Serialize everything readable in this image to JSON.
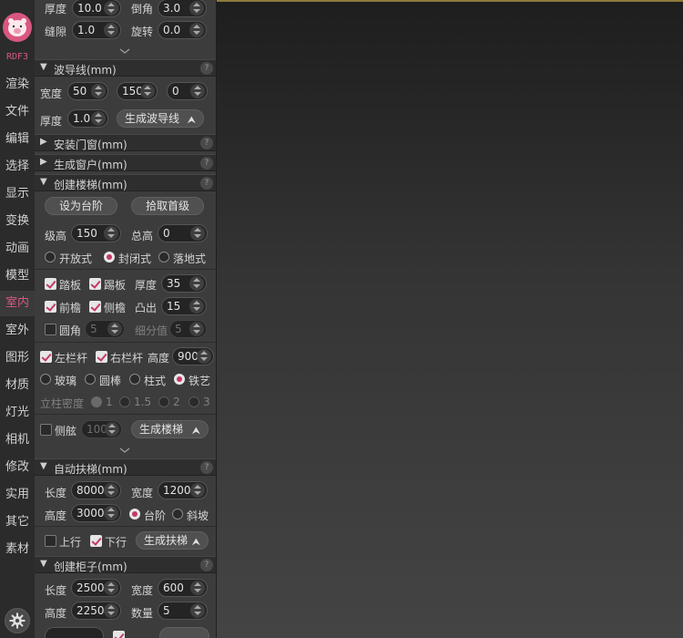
{
  "brand": {
    "logo_text": "RDF3",
    "accent": "#d9577f"
  },
  "nav": [
    "渲染",
    "文件",
    "编辑",
    "选择",
    "显示",
    "变换",
    "动画",
    "模型",
    "室内",
    "室外",
    "图形",
    "材质",
    "灯光",
    "相机",
    "修改",
    "实用",
    "其它",
    "素材"
  ],
  "nav_active": "室内",
  "top": {
    "thickness_label": "厚度",
    "thickness": "10.0",
    "chamfer_label": "倒角",
    "chamfer": "3.0",
    "gap_label": "缝隙",
    "gap": "1.0",
    "rotate_label": "旋转",
    "rotate": "0.0"
  },
  "waveguide": {
    "title": "波导线(mm)",
    "help": "?",
    "width_label": "宽度",
    "w1": "50",
    "w2": "150",
    "w3": "0",
    "thick_label": "厚度",
    "thick": "1.0",
    "gen_button": "生成波导线"
  },
  "door": {
    "title": "安装门窗(mm)",
    "help": "?"
  },
  "window": {
    "title": "生成窗户(mm)",
    "help": "?"
  },
  "stairs": {
    "title": "创建楼梯(mm)",
    "help": "?",
    "set_step": "设为台阶",
    "pick_first": "拾取首级",
    "step_h_label": "级高",
    "step_h": "150",
    "total_h_label": "总高",
    "total_h": "0",
    "types": [
      "开放式",
      "封闭式",
      "落地式"
    ],
    "type_selected": "封闭式",
    "tread_label": "踏板",
    "riser_label": "踢板",
    "thick_label": "厚度",
    "thick": "35",
    "front_label": "前檐",
    "side_label": "侧檐",
    "bulge_label": "凸出",
    "bulge": "15",
    "round_label": "圆角",
    "round": "5",
    "subdiv_label": "细分值",
    "subdiv": "5",
    "left_rail": "左栏杆",
    "right_rail": "右栏杆",
    "rail_h_label": "高度",
    "rail_h": "900",
    "rail_types": [
      "玻璃",
      "圆棒",
      "柱式",
      "铁艺"
    ],
    "rail_selected": "铁艺",
    "density_label": "立柱密度",
    "densities": [
      "1",
      "1.5",
      "2",
      "3"
    ],
    "density_selected": "1",
    "stringer_label": "侧舷",
    "stringer": "100",
    "gen_button": "生成楼梯"
  },
  "escalator": {
    "title": "自动扶梯(mm)",
    "help": "?",
    "len_label": "长度",
    "len": "8000",
    "width_label": "宽度",
    "width": "1200",
    "height_label": "高度",
    "height": "3000",
    "modes": [
      "台阶",
      "斜坡"
    ],
    "mode_selected": "台阶",
    "up_label": "上行",
    "down_label": "下行",
    "gen_button": "生成扶梯"
  },
  "cabinet": {
    "title": "创建柜子(mm)",
    "help": "?",
    "len_label": "长度",
    "len": "2500",
    "width_label": "宽度",
    "width": "600",
    "height_label": "高度",
    "height": "2250",
    "count_label": "数量",
    "count": "5"
  }
}
